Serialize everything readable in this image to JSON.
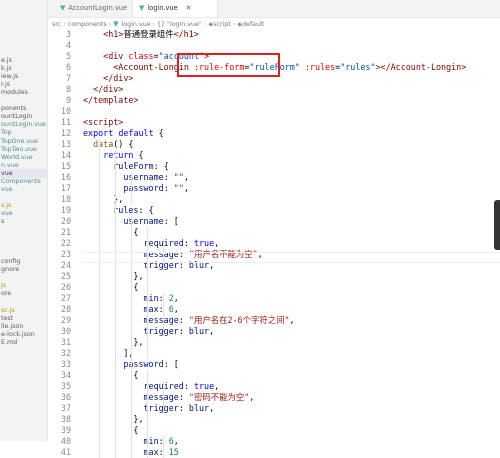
{
  "sidebar": {
    "items": [
      {
        "label": "e.js",
        "cls": ""
      },
      {
        "label": "k.js",
        "cls": ""
      },
      {
        "label": "iew.js",
        "cls": ""
      },
      {
        "label": "r.js",
        "cls": ""
      },
      {
        "label": "modules",
        "cls": ""
      },
      {
        "label": "",
        "cls": ""
      },
      {
        "label": "ponents",
        "cls": ""
      },
      {
        "label": "ountLogin",
        "cls": ""
      },
      {
        "label": "ountLogin.vue",
        "cls": "teal"
      },
      {
        "label": "Top",
        "cls": "teal"
      },
      {
        "label": "TopOne.vue",
        "cls": "teal"
      },
      {
        "label": "TopTwo.vue",
        "cls": "teal"
      },
      {
        "label": "World.vue",
        "cls": "teal"
      },
      {
        "label": "n.vue",
        "cls": "teal"
      },
      {
        "label": "vue",
        "cls": "active"
      },
      {
        "label": "Components",
        "cls": "teal"
      },
      {
        "label": "vue",
        "cls": "teal"
      },
      {
        "label": "",
        "cls": ""
      },
      {
        "label": "s.js",
        "cls": "yellow"
      },
      {
        "label": "vue",
        "cls": "teal"
      },
      {
        "label": "s",
        "cls": ""
      },
      {
        "label": "",
        "cls": ""
      },
      {
        "label": "",
        "cls": ""
      },
      {
        "label": "",
        "cls": ""
      },
      {
        "label": "",
        "cls": ""
      },
      {
        "label": "config",
        "cls": ""
      },
      {
        "label": "gnore",
        "cls": ""
      },
      {
        "label": "",
        "cls": ""
      },
      {
        "label": "js",
        "cls": "yellow"
      },
      {
        "label": "ore",
        "cls": ""
      },
      {
        "label": "",
        "cls": ""
      },
      {
        "label": "sc.js",
        "cls": "yellow"
      },
      {
        "label": "test",
        "cls": ""
      },
      {
        "label": "ile.json",
        "cls": ""
      },
      {
        "label": "e-lock.json",
        "cls": ""
      },
      {
        "label": "E.md",
        "cls": ""
      }
    ]
  },
  "tabs": [
    {
      "label": "AccountLogin.vue",
      "active": false
    },
    {
      "label": "login.vue",
      "active": true
    }
  ],
  "breadcrumb": {
    "path": [
      "src",
      "components",
      "login.vue",
      "{} \"login.vue\"",
      "script",
      "default"
    ]
  },
  "editor": {
    "first_line": 3,
    "lines": [
      [
        {
          "t": "    "
        },
        {
          "t": "<h1>",
          "c": "t-tag"
        },
        {
          "t": "普通登录组件"
        },
        {
          "t": "</h1>",
          "c": "t-tag"
        }
      ],
      [],
      [
        {
          "t": "    "
        },
        {
          "t": "<div",
          "c": "t-tag"
        },
        {
          "t": " "
        },
        {
          "t": "class",
          "c": "t-attr"
        },
        {
          "t": "="
        },
        {
          "t": "\"account\"",
          "c": "t-str"
        },
        {
          "t": ">",
          "c": "t-tag"
        }
      ],
      [
        {
          "t": "      "
        },
        {
          "t": "<Account-Longin",
          "c": "t-tag"
        },
        {
          "t": " "
        },
        {
          "t": ":rule-form",
          "c": "t-attr"
        },
        {
          "t": "="
        },
        {
          "t": "\"ruleForm\"",
          "c": "t-str"
        },
        {
          "t": " "
        },
        {
          "t": ":rules",
          "c": "t-attr"
        },
        {
          "t": "="
        },
        {
          "t": "\"rules\"",
          "c": "t-str"
        },
        {
          "t": "></Account-Longin>",
          "c": "t-tag"
        }
      ],
      [
        {
          "t": "    "
        },
        {
          "t": "</div>",
          "c": "t-tag"
        }
      ],
      [
        {
          "t": "  "
        },
        {
          "t": "</div>",
          "c": "t-tag"
        }
      ],
      [
        {
          "t": "</template>",
          "c": "t-tag"
        }
      ],
      [],
      [
        {
          "t": "<script>",
          "c": "t-tag"
        }
      ],
      [
        {
          "t": "export",
          "c": "t-kw"
        },
        {
          "t": " "
        },
        {
          "t": "default",
          "c": "t-kw"
        },
        {
          "t": " {"
        }
      ],
      [
        {
          "t": "  "
        },
        {
          "t": "data",
          "c": "t-fn"
        },
        {
          "t": "() {"
        }
      ],
      [
        {
          "t": "    "
        },
        {
          "t": "return",
          "c": "t-kw"
        },
        {
          "t": " {"
        }
      ],
      [
        {
          "t": "      "
        },
        {
          "t": "ruleForm",
          "c": "t-prop"
        },
        {
          "t": ": {"
        }
      ],
      [
        {
          "t": "        "
        },
        {
          "t": "username",
          "c": "t-prop"
        },
        {
          "t": ": "
        },
        {
          "t": "\"\"",
          "c": "t-cn"
        },
        {
          "t": ","
        }
      ],
      [
        {
          "t": "        "
        },
        {
          "t": "password",
          "c": "t-prop"
        },
        {
          "t": ": "
        },
        {
          "t": "\"\"",
          "c": "t-cn"
        },
        {
          "t": ","
        }
      ],
      [
        {
          "t": "      },"
        }
      ],
      [
        {
          "t": "      "
        },
        {
          "t": "rules",
          "c": "t-prop"
        },
        {
          "t": ": {"
        }
      ],
      [
        {
          "t": "        "
        },
        {
          "t": "username",
          "c": "t-prop"
        },
        {
          "t": ": ["
        }
      ],
      [
        {
          "t": "          {"
        }
      ],
      [
        {
          "t": "            "
        },
        {
          "t": "required",
          "c": "t-prop"
        },
        {
          "t": ": "
        },
        {
          "t": "true",
          "c": "t-kw"
        },
        {
          "t": ","
        }
      ],
      [
        {
          "t": "            "
        },
        {
          "t": "message",
          "c": "t-prop"
        },
        {
          "t": ": "
        },
        {
          "t": "\"用户名不能为空\"",
          "c": "t-cn"
        },
        {
          "t": ","
        }
      ],
      [
        {
          "t": "            "
        },
        {
          "t": "trigger",
          "c": "t-prop"
        },
        {
          "t": ": "
        },
        {
          "t": "blur",
          "c": "t-prop"
        },
        {
          "t": ","
        }
      ],
      [
        {
          "t": "          },"
        }
      ],
      [
        {
          "t": "          {"
        }
      ],
      [
        {
          "t": "            "
        },
        {
          "t": "min",
          "c": "t-prop"
        },
        {
          "t": ": "
        },
        {
          "t": "2",
          "c": "t-num"
        },
        {
          "t": ","
        }
      ],
      [
        {
          "t": "            "
        },
        {
          "t": "max",
          "c": "t-prop"
        },
        {
          "t": ": "
        },
        {
          "t": "6",
          "c": "t-num"
        },
        {
          "t": ","
        }
      ],
      [
        {
          "t": "            "
        },
        {
          "t": "message",
          "c": "t-prop"
        },
        {
          "t": ": "
        },
        {
          "t": "\"用户名在2-6个字符之间\"",
          "c": "t-cn"
        },
        {
          "t": ","
        }
      ],
      [
        {
          "t": "            "
        },
        {
          "t": "trigger",
          "c": "t-prop"
        },
        {
          "t": ": "
        },
        {
          "t": "blur",
          "c": "t-prop"
        },
        {
          "t": ","
        }
      ],
      [
        {
          "t": "          },"
        }
      ],
      [
        {
          "t": "        ],"
        }
      ],
      [
        {
          "t": "        "
        },
        {
          "t": "password",
          "c": "t-prop"
        },
        {
          "t": ": ["
        }
      ],
      [
        {
          "t": "          {"
        }
      ],
      [
        {
          "t": "            "
        },
        {
          "t": "required",
          "c": "t-prop"
        },
        {
          "t": ": "
        },
        {
          "t": "true",
          "c": "t-kw"
        },
        {
          "t": ","
        }
      ],
      [
        {
          "t": "            "
        },
        {
          "t": "message",
          "c": "t-prop"
        },
        {
          "t": ": "
        },
        {
          "t": "\"密码不能为空\"",
          "c": "t-cn"
        },
        {
          "t": ","
        }
      ],
      [
        {
          "t": "            "
        },
        {
          "t": "trigger",
          "c": "t-prop"
        },
        {
          "t": ": "
        },
        {
          "t": "blur",
          "c": "t-prop"
        },
        {
          "t": ","
        }
      ],
      [
        {
          "t": "          },"
        }
      ],
      [
        {
          "t": "          {"
        }
      ],
      [
        {
          "t": "            "
        },
        {
          "t": "min",
          "c": "t-prop"
        },
        {
          "t": ": "
        },
        {
          "t": "6",
          "c": "t-num"
        },
        {
          "t": ","
        }
      ],
      [
        {
          "t": "            "
        },
        {
          "t": "max",
          "c": "t-prop"
        },
        {
          "t": ": "
        },
        {
          "t": "15",
          "c": "t-num"
        }
      ]
    ]
  }
}
